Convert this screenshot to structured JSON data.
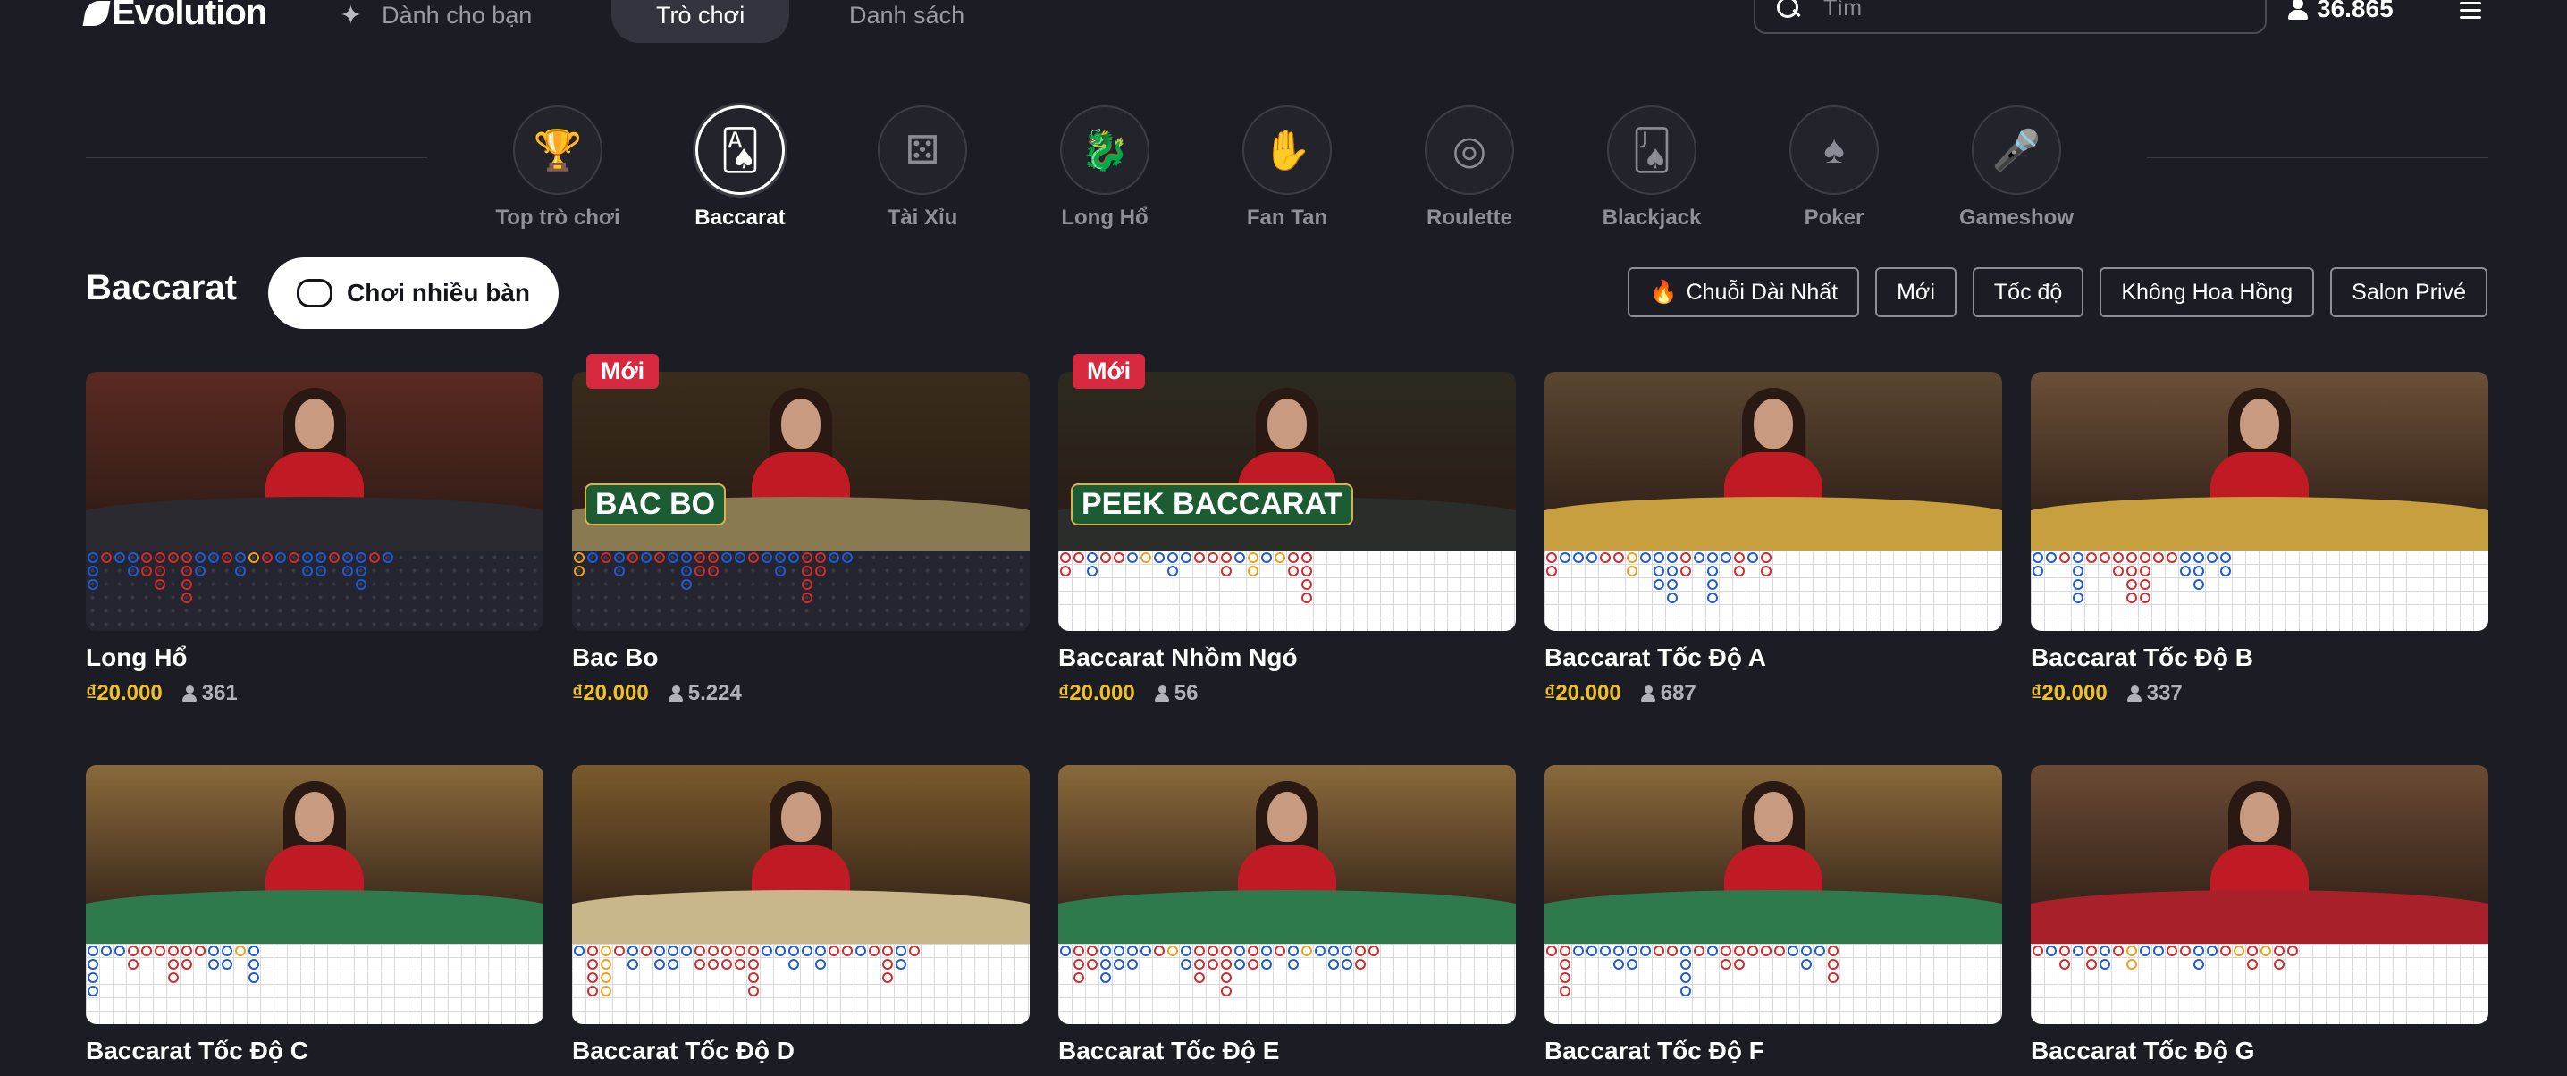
{
  "header": {
    "logo_text": "Evolution",
    "nav": [
      {
        "label": "Dành cho bạn",
        "icon": "sparkle-icon"
      },
      {
        "label": "Trò chơi",
        "active": true
      },
      {
        "label": "Danh sách"
      }
    ],
    "search": {
      "placeholder": "Tìm",
      "value": ""
    },
    "online_count": "36.865"
  },
  "categories": [
    {
      "label": "Top trò chơi",
      "icon": "podium-icon"
    },
    {
      "label": "Baccarat",
      "icon": "baccarat-cards-icon",
      "active": true
    },
    {
      "label": "Tài Xỉu",
      "icon": "dice-icon"
    },
    {
      "label": "Long Hổ",
      "icon": "dragon-tiger-icon"
    },
    {
      "label": "Fan Tan",
      "icon": "fan-tan-icon"
    },
    {
      "label": "Roulette",
      "icon": "roulette-wheel-icon"
    },
    {
      "label": "Blackjack",
      "icon": "blackjack-cards-icon"
    },
    {
      "label": "Poker",
      "icon": "poker-cards-icon"
    },
    {
      "label": "Gameshow",
      "icon": "microphone-icon"
    }
  ],
  "section": {
    "title": "Baccarat",
    "multi_table_label": "Chơi nhiều bàn",
    "filters": [
      {
        "label": "Chuỗi Dài Nhất",
        "icon": "flame-icon"
      },
      {
        "label": "Mới"
      },
      {
        "label": "Tốc độ"
      },
      {
        "label": "Không Hoa Hồng"
      },
      {
        "label": "Salon Privé"
      }
    ]
  },
  "games": [
    {
      "name": "Long Hổ",
      "price": "₫20.000",
      "players": "361",
      "badge": "",
      "table_color": "#2b2a30",
      "bg": "#5a2a22",
      "road": "dark"
    },
    {
      "name": "Bac Bo",
      "price": "₫20.000",
      "players": "5.224",
      "badge": "Mới",
      "table_color": "#8a7a52",
      "bg": "#3a2c1c",
      "road": "dark",
      "overlay": "BAC BO"
    },
    {
      "name": "Baccarat Nhồm Ngó",
      "price": "₫20.000",
      "players": "56",
      "badge": "Mới",
      "table_color": "#2a2d29",
      "bg": "#2c2a1e",
      "road": "light",
      "overlay": "PEEK BACCARAT"
    },
    {
      "name": "Baccarat Tốc Độ A",
      "price": "₫20.000",
      "players": "687",
      "badge": "",
      "table_color": "#c79f3e",
      "bg": "#5a4630",
      "road": "light"
    },
    {
      "name": "Baccarat Tốc Độ B",
      "price": "₫20.000",
      "players": "337",
      "badge": "",
      "table_color": "#c79f3e",
      "bg": "#6b5038",
      "road": "light"
    },
    {
      "name": "Baccarat Tốc Độ C",
      "price": "",
      "players": "",
      "badge": "",
      "table_color": "#2f7a4c",
      "bg": "#8a6a3c",
      "road": "light"
    },
    {
      "name": "Baccarat Tốc Độ D",
      "price": "",
      "players": "",
      "badge": "",
      "table_color": "#c9b68a",
      "bg": "#7a5a2c",
      "road": "light"
    },
    {
      "name": "Baccarat Tốc Độ E",
      "price": "",
      "players": "",
      "badge": "",
      "table_color": "#2f7a4c",
      "bg": "#8a6a3c",
      "road": "light"
    },
    {
      "name": "Baccarat Tốc Độ F",
      "price": "",
      "players": "",
      "badge": "",
      "table_color": "#2f7a4c",
      "bg": "#8a6a3c",
      "road": "light"
    },
    {
      "name": "Baccarat Tốc Độ G",
      "price": "",
      "players": "",
      "badge": "",
      "table_color": "#a8202a",
      "bg": "#6a4a34",
      "road": "light"
    }
  ],
  "colors": {
    "accent_price": "#f2c21c",
    "badge_new": "#d6293f",
    "player_blue": "#1f5bd6",
    "banker_red": "#d62b2b",
    "tie_orange": "#f0a01c"
  }
}
